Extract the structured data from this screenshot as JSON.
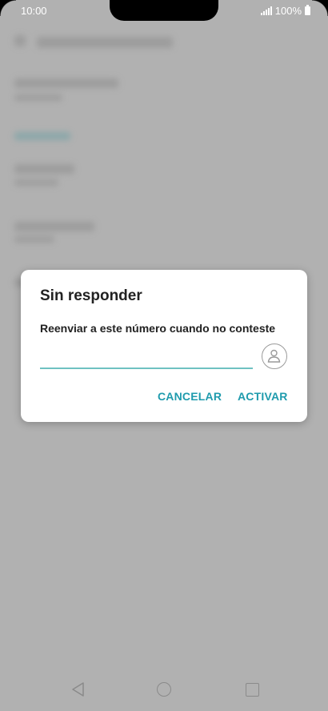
{
  "status_bar": {
    "time": "10:00",
    "battery_text": "100%"
  },
  "dialog": {
    "title": "Sin responder",
    "message": "Reenviar a este número cuando no conteste",
    "phone_input": {
      "value": "",
      "placeholder": ""
    },
    "contact_icon": "person-icon",
    "cancel_label": "CANCELAR",
    "activate_label": "ACTIVAR"
  },
  "nav_bar": {
    "icons": [
      "back-icon",
      "home-icon",
      "recent-apps-icon"
    ]
  },
  "colors": {
    "accent": "#1f9bad",
    "input_underline": "#6fc2c2",
    "scrim": "#b1b1b1"
  }
}
